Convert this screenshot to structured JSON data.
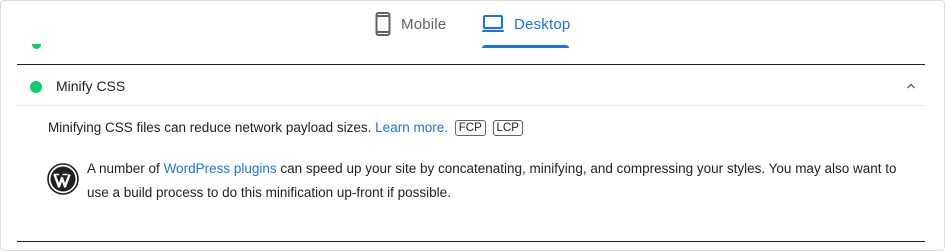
{
  "tabs": [
    {
      "label": "Mobile",
      "icon": "mobile-phone-icon",
      "selected": false
    },
    {
      "label": "Desktop",
      "icon": "laptop-icon",
      "selected": true
    }
  ],
  "colors": {
    "accent": "#1a73e8",
    "pass": "#0cce6b",
    "text": "#202124",
    "muted": "#5f6368"
  },
  "audit": {
    "title": "Minify CSS",
    "status": "pass",
    "expanded": true,
    "description": "Minifying CSS files can reduce network payload sizes.",
    "learn_more": "Learn more.",
    "metric_tags": [
      "FCP",
      "LCP"
    ],
    "stack_pack": {
      "icon": "wordpress-logo-icon",
      "text_before": "A number of",
      "link": "WordPress plugins",
      "text_after": "can speed up your site by concatenating, minifying, and compressing your styles. You may also want to use a build process to do this minification up-front if possible."
    }
  }
}
